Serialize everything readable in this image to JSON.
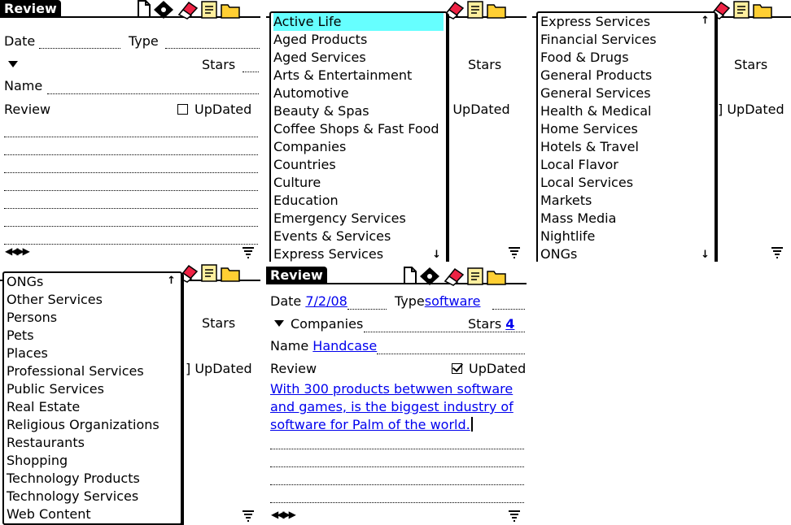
{
  "app_title": "Review",
  "form": {
    "date_label": "Date",
    "type_label": "Type",
    "stars_label": "Stars",
    "name_label": "Name",
    "review_label": "Review",
    "updated_label": "UpDated"
  },
  "filled": {
    "date_value": "7/2/08",
    "type_value": "software",
    "category_value": "Companies",
    "stars_value": "4",
    "name_value": "Handcase",
    "review_lines": [
      "With 300 products betwwen software",
      "and games, is the biggest industry of",
      "software for Palm of the world."
    ],
    "updated_checked": true
  },
  "categories_page1": [
    "Active Life",
    "Aged Products",
    "Aged Services",
    "Arts & Entertainment",
    "Automotive",
    "Beauty & Spas",
    "Coffee Shops & Fast Food",
    "Companies",
    "Countries",
    "Culture",
    "Education",
    "Emergency Services",
    "Events & Services",
    "Express Services"
  ],
  "categories_page2": [
    "Express Services",
    "Financial Services",
    "Food & Drugs",
    "General Products",
    "General Services",
    "Health & Medical",
    "Home Services",
    "Hotels & Travel",
    "Local Flavor",
    "Local Services",
    "Markets",
    "Mass Media",
    "Nightlife",
    "ONGs"
  ],
  "categories_page3": [
    "ONGs",
    "Other Services",
    "Persons",
    "Pets",
    "Places",
    "Professional Services",
    "Public Services",
    "Real Estate",
    "Religious Organizations",
    "Restaurants",
    "Shopping",
    "Technology Products",
    "Technology Services",
    "Web Content"
  ],
  "colors": {
    "selection": "#66ffff",
    "value_text": "#0000ee"
  },
  "icons": [
    "new-record-icon",
    "navigation-icon",
    "eraser-icon",
    "memo-icon",
    "folder-icon",
    "scroll-down-icon",
    "scroll-up-icon",
    "graffiti-icon"
  ]
}
